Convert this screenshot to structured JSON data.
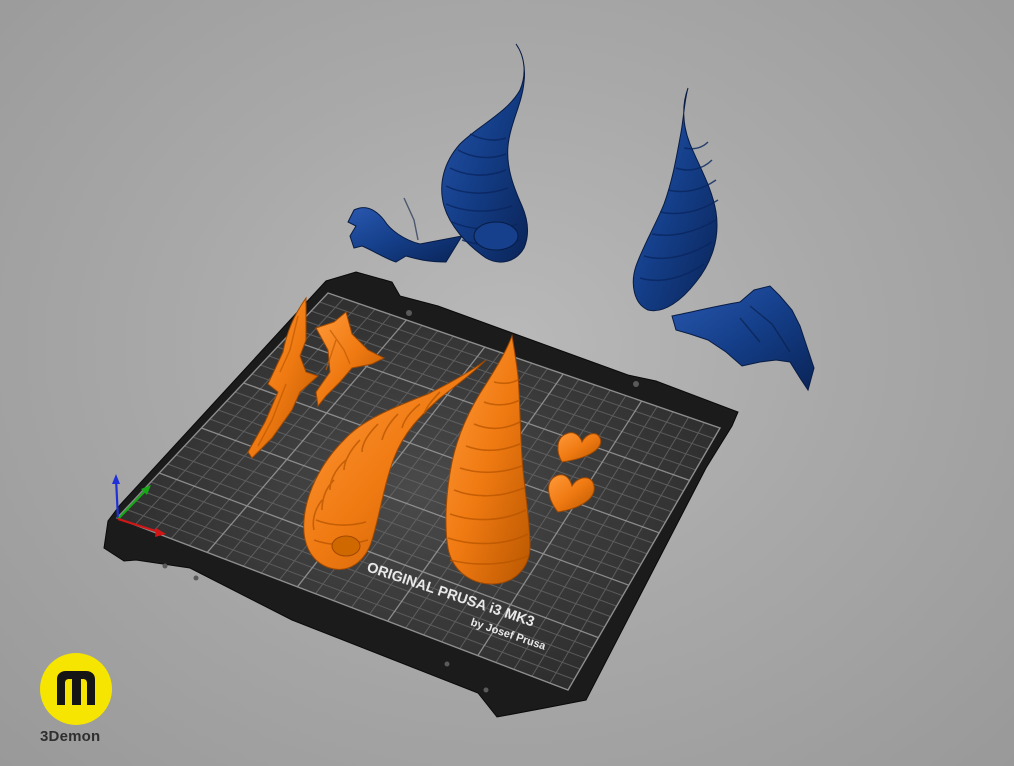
{
  "scene": {
    "background_color": "#aaaaaa",
    "printer_model_line": "ORIGINAL PRUSA i3 MK3",
    "printer_maker_line": "by Josef Prusa"
  },
  "objects": {
    "on_bed_color": "#f07a12",
    "off_bed_color": "#123a80",
    "on_bed": [
      "wing-left-small",
      "wing-right-small",
      "horn-left",
      "horn-right",
      "heart-top",
      "heart-bottom"
    ],
    "off_bed": [
      "horn-with-wing-top-left",
      "horn-with-wing-right"
    ]
  },
  "axes": {
    "x_color": "#d01616",
    "y_color": "#18a818",
    "z_color": "#2030d8"
  },
  "branding": {
    "logo_name": "3Demon",
    "logo_color": "#f6e500"
  }
}
